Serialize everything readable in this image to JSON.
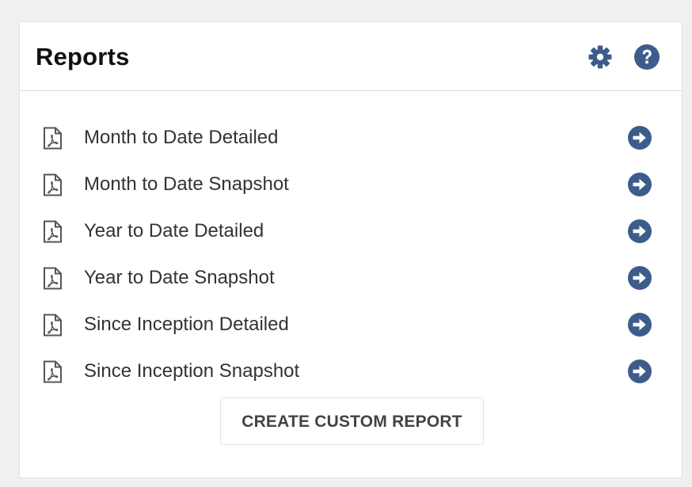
{
  "panel": {
    "title": "Reports",
    "icons": {
      "settings": "gear-icon",
      "help": "question-circle-icon"
    }
  },
  "colors": {
    "accent": "#3d5c8c",
    "text": "#333333",
    "pdf_icon": "#555555",
    "background": "#f0f0f0"
  },
  "reports": [
    {
      "label": "Month to Date Detailed",
      "icon": "pdf-file-icon",
      "action_icon": "arrow-circle-right-icon"
    },
    {
      "label": "Month to Date Snapshot",
      "icon": "pdf-file-icon",
      "action_icon": "arrow-circle-right-icon"
    },
    {
      "label": "Year to Date Detailed",
      "icon": "pdf-file-icon",
      "action_icon": "arrow-circle-right-icon"
    },
    {
      "label": "Year to Date Snapshot",
      "icon": "pdf-file-icon",
      "action_icon": "arrow-circle-right-icon"
    },
    {
      "label": "Since Inception Detailed",
      "icon": "pdf-file-icon",
      "action_icon": "arrow-circle-right-icon"
    },
    {
      "label": "Since Inception Snapshot",
      "icon": "pdf-file-icon",
      "action_icon": "arrow-circle-right-icon"
    }
  ],
  "actions": {
    "custom_report_label": "CREATE CUSTOM REPORT"
  }
}
